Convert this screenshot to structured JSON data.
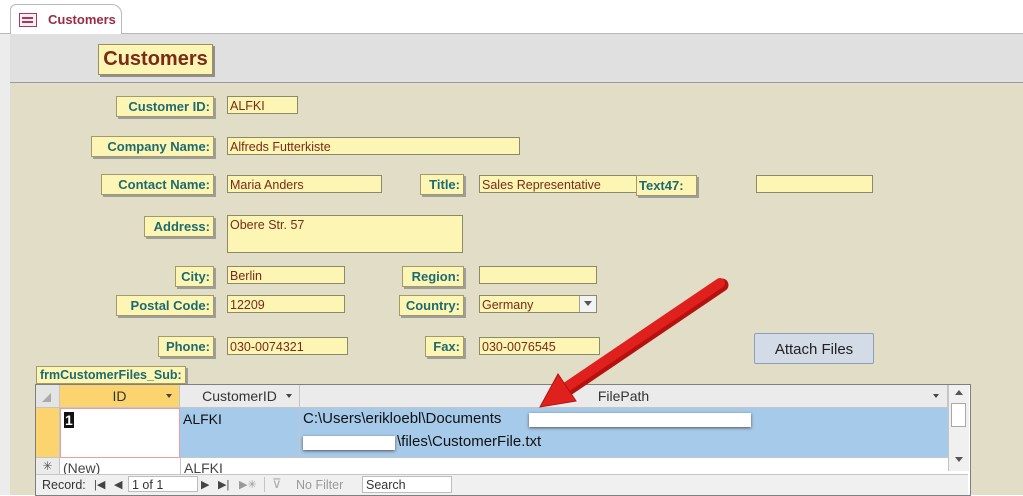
{
  "tab": {
    "label": "Customers"
  },
  "form": {
    "title": "Customers",
    "fields": {
      "customer_id": {
        "label": "Customer ID:",
        "value": "ALFKI"
      },
      "company_name": {
        "label": "Company Name:",
        "value": "Alfreds Futterkiste"
      },
      "contact_name": {
        "label": "Contact Name:",
        "value": "Maria Anders"
      },
      "title": {
        "label": "Title:",
        "value": "Sales Representative"
      },
      "text47": {
        "label": "Text47:",
        "value": ""
      },
      "address": {
        "label": "Address:",
        "value": "Obere Str. 57"
      },
      "city": {
        "label": "City:",
        "value": "Berlin"
      },
      "region": {
        "label": "Region:",
        "value": ""
      },
      "postal_code": {
        "label": "Postal Code:",
        "value": "12209"
      },
      "country": {
        "label": "Country:",
        "value": "Germany"
      },
      "phone": {
        "label": "Phone:",
        "value": "030-0074321"
      },
      "fax": {
        "label": "Fax:",
        "value": "030-0076545"
      }
    },
    "attach_button": "Attach Files"
  },
  "subform": {
    "label": "frmCustomerFiles_Sub:",
    "columns": [
      "ID",
      "CustomerID",
      "FilePath"
    ],
    "rows": [
      {
        "id": "1",
        "customer_id": "ALFKI",
        "filepath_line1": "C:\\Users\\erikloebl\\Documents",
        "filepath_line2": "\\files\\CustomerFile.txt"
      }
    ],
    "new_row": {
      "id": "(New)",
      "customer_id": "ALFKI"
    },
    "nav": {
      "record_label": "Record:",
      "position": "1 of 1",
      "filter": "No Filter",
      "search": "Search"
    }
  },
  "colors": {
    "label_bg": "#fcf5b4",
    "label_text": "#1d6a70",
    "value_text": "#7a2a16",
    "detail_bg": "#e1ddc7",
    "selected_row": "#a6caea",
    "arrow": "#e0201c"
  }
}
